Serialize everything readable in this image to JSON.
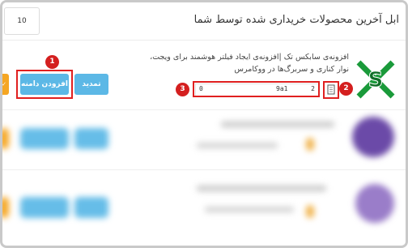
{
  "header": {
    "title": "ابل آخرین محصولات خریداری شده توسط شما",
    "page_size_value": "10"
  },
  "product": {
    "description": "افزونه‌ی سابکس تک |افزونه‌ی ایجاد فیلتر هوشمند برای ویجت، نوار کناری و سربرگ‌ها در ووکامرس",
    "logo_icon": "sabox-s-logo"
  },
  "buttons": {
    "add_domain_label": "افزودن دامنه",
    "renew_label": "تمدید"
  },
  "license": {
    "start": "0",
    "middle": "9a1",
    "end": "2"
  },
  "markers": [
    "1",
    "2",
    "3"
  ],
  "colors": {
    "button_blue": "#5cb8e6",
    "highlight_red": "#e02020",
    "marker_red": "#d41f1f",
    "accent_orange": "#f5a623",
    "logo_green": "#1a9a3a"
  }
}
